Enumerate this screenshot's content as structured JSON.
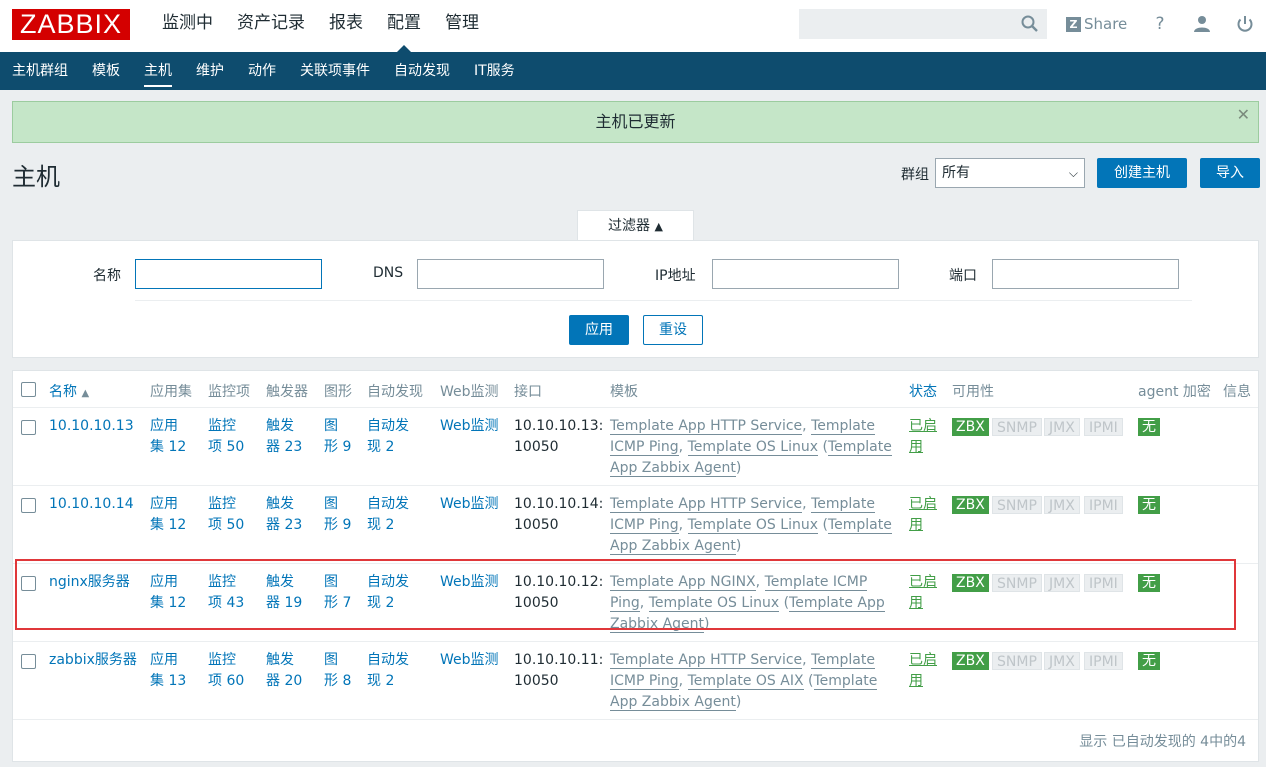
{
  "logo": "ZABBIX",
  "main_menu": [
    "监测中",
    "资产记录",
    "报表",
    "配置",
    "管理"
  ],
  "header_tools": {
    "share": "Share",
    "help": "?",
    "user_icon": "user-icon",
    "power_icon": "power-icon"
  },
  "sub_menu": [
    "主机群组",
    "模板",
    "主机",
    "维护",
    "动作",
    "关联项事件",
    "自动发现",
    "IT服务"
  ],
  "message": "主机已更新",
  "page_title": "主机",
  "group_label": "群组",
  "group_value": "所有",
  "create_button": "创建主机",
  "import_button": "导入",
  "filter": {
    "tab_label": "过滤器",
    "tab_arrow": "▲",
    "name_label": "名称",
    "dns_label": "DNS",
    "ip_label": "IP地址",
    "port_label": "端口",
    "apply": "应用",
    "reset": "重设"
  },
  "table": {
    "headers": {
      "name": "名称",
      "sort_arrow": "▲",
      "applications": "应用集",
      "items": "监控项",
      "triggers": "触发器",
      "graphs": "图形",
      "discovery": "自动发现",
      "web": "Web监测",
      "interface": "接口",
      "templates": "模板",
      "status": "状态",
      "availability": "可用性",
      "encryption": "agent 加密",
      "info": "信息"
    },
    "rows": [
      {
        "name": "10.10.10.13",
        "app_a": "应用",
        "app_b": "集 12",
        "item_a": "监控",
        "item_b": "项 50",
        "trig_a": "触发",
        "trig_b": "器 23",
        "graph_a": "图",
        "graph_b": "形 9",
        "disc_a": "自动发",
        "disc_b": "现 2",
        "web": "Web监测",
        "iface_a": "10.10.10.13:",
        "iface_b": "10050",
        "tpl_1": "Template App HTTP Service",
        "tpl_2": "Template",
        "tpl_3": "ICMP Ping",
        "tpl_4": "Template OS Linux",
        "tpl_5": "Template",
        "tpl_6": "App Zabbix Agent",
        "status_a": "已启",
        "status_b": "用",
        "zbx": "ZBX",
        "snmp": "SNMP",
        "jmx": "JMX",
        "ipmi": "IPMI",
        "enc": "无"
      },
      {
        "name": "10.10.10.14",
        "app_a": "应用",
        "app_b": "集 12",
        "item_a": "监控",
        "item_b": "项 50",
        "trig_a": "触发",
        "trig_b": "器 23",
        "graph_a": "图",
        "graph_b": "形 9",
        "disc_a": "自动发",
        "disc_b": "现 2",
        "web": "Web监测",
        "iface_a": "10.10.10.14:",
        "iface_b": "10050",
        "tpl_1": "Template App HTTP Service",
        "tpl_2": "Template",
        "tpl_3": "ICMP Ping",
        "tpl_4": "Template OS Linux",
        "tpl_5": "Template",
        "tpl_6": "App Zabbix Agent",
        "status_a": "已启",
        "status_b": "用",
        "zbx": "ZBX",
        "snmp": "SNMP",
        "jmx": "JMX",
        "ipmi": "IPMI",
        "enc": "无"
      },
      {
        "name": "nginx服务器",
        "app_a": "应用",
        "app_b": "集 12",
        "item_a": "监控",
        "item_b": "项 43",
        "trig_a": "触发",
        "trig_b": "器 19",
        "graph_a": "图",
        "graph_b": "形 7",
        "disc_a": "自动发",
        "disc_b": "现 2",
        "web": "Web监测",
        "iface_a": "10.10.10.12:",
        "iface_b": "10050",
        "tpl_1": "Template App NGINX",
        "tpl_2": "Template ICMP",
        "tpl_3": "Ping",
        "tpl_4": "Template OS Linux",
        "tpl_5": "Template App",
        "tpl_6": "Zabbix Agent",
        "status_a": "已启",
        "status_b": "用",
        "zbx": "ZBX",
        "snmp": "SNMP",
        "jmx": "JMX",
        "ipmi": "IPMI",
        "enc": "无"
      },
      {
        "name": "zabbix服务器",
        "app_a": "应用",
        "app_b": "集 13",
        "item_a": "监控",
        "item_b": "项 60",
        "trig_a": "触发",
        "trig_b": "器 20",
        "graph_a": "图",
        "graph_b": "形 8",
        "disc_a": "自动发",
        "disc_b": "现 2",
        "web": "Web监测",
        "iface_a": "10.10.10.11:",
        "iface_b": "10050",
        "tpl_1": "Template App HTTP Service",
        "tpl_2": "Template",
        "tpl_3": "ICMP Ping",
        "tpl_4": "Template OS AIX",
        "tpl_5": "Template",
        "tpl_6": "App Zabbix Agent",
        "status_a": "已启",
        "status_b": "用",
        "zbx": "ZBX",
        "snmp": "SNMP",
        "jmx": "JMX",
        "ipmi": "IPMI",
        "enc": "无"
      }
    ]
  },
  "footer": "显示 已自动发现的 4中的4",
  "colors": {
    "brand": "#d40000",
    "nav": "#0e4c6e",
    "link": "#0275b8",
    "enabled": "#429e47",
    "highlight": "#e0373a",
    "message_bg": "#c5e6c8"
  }
}
